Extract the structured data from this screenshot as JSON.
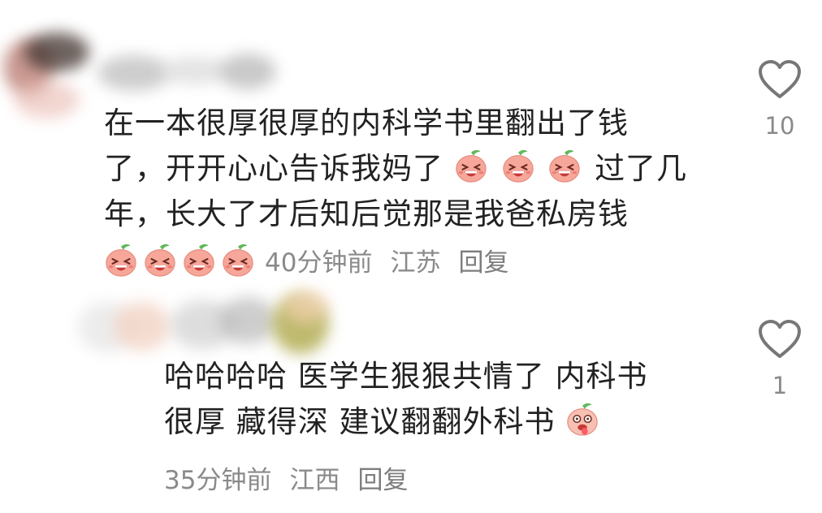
{
  "comments": [
    {
      "text_line1": "在一本很厚很厚的内科学书里翻出了钱",
      "text_line2_before": "了，开开心心告诉我妈了",
      "text_line2_after": "过了几",
      "text_line3": "年，长大了才后知后觉那是我爸私房钱",
      "inline_emoji_count": 3,
      "trailing_emoji_count": 4,
      "emoji_icon": "laughing-peach-icon",
      "time": "40分钟前",
      "location": "江苏",
      "reply_label": "回复",
      "like_count": "10"
    },
    {
      "text_line1": "哈哈哈哈 医学生狠狠共情了 内科书",
      "text_line2": "很厚 藏得深 建议翻翻外科书",
      "emoji_icon": "tongue-peach-icon",
      "time": "35分钟前",
      "location": "江西",
      "reply_label": "回复",
      "like_count": "1"
    }
  ],
  "colors": {
    "text": "#222222",
    "meta": "#8a8a8a",
    "peach": "#f6a79a",
    "leaf": "#5fb85a"
  }
}
